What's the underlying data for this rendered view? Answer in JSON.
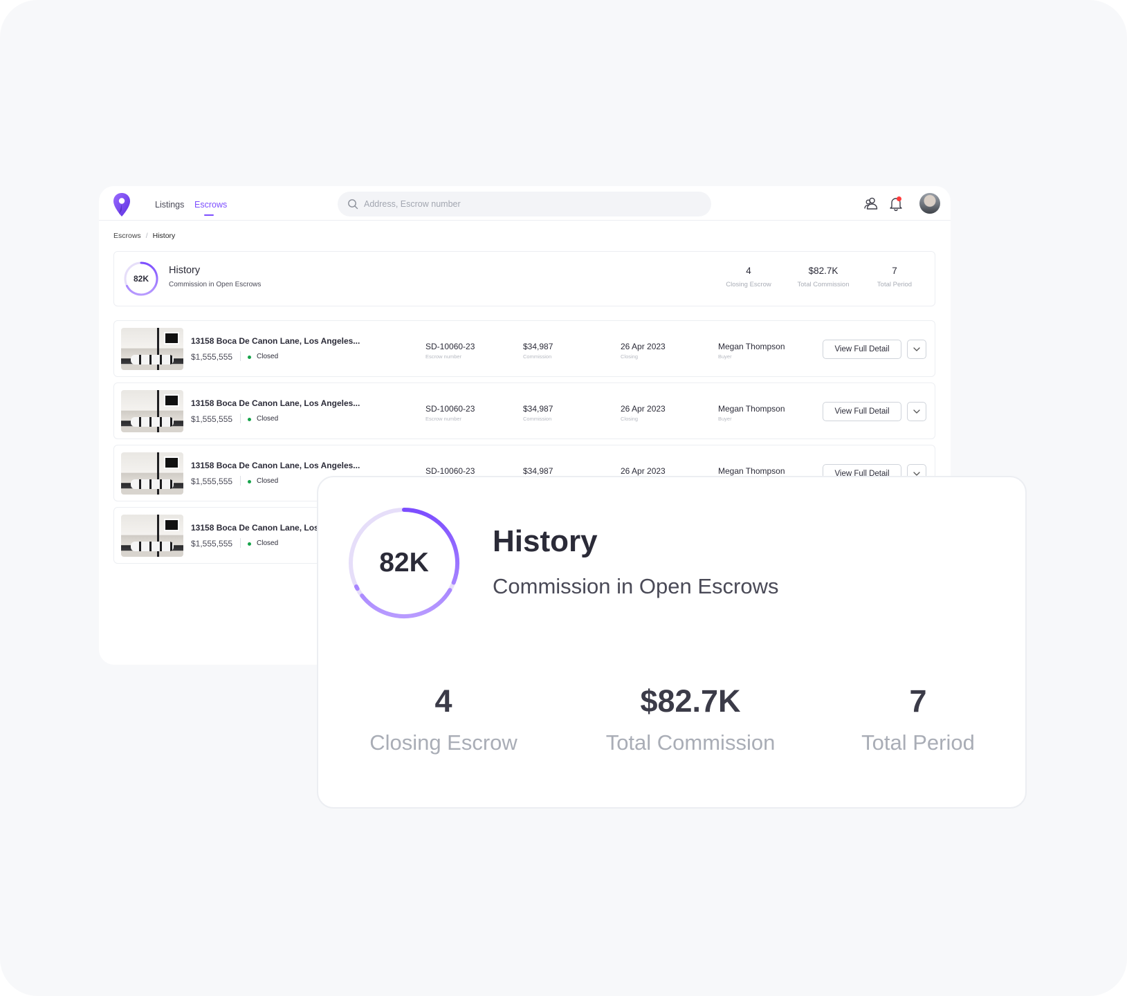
{
  "nav": {
    "links": [
      "Listings",
      "Escrows"
    ],
    "active": "Escrows"
  },
  "search": {
    "placeholder": "Address, Escrow number"
  },
  "icons": {
    "logo": "map-pin-logo-icon",
    "search": "search-icon",
    "users": "users-icon",
    "notifications": "bell-icon",
    "chevron": "chevron-down-icon"
  },
  "breadcrumb": {
    "parent": "Escrows",
    "separator": "/",
    "current": "History"
  },
  "summary": {
    "ring_label": "82K",
    "title": "History",
    "subtitle": "Commission in Open Escrows",
    "stats": [
      {
        "value": "4",
        "label": "Closing Escrow"
      },
      {
        "value": "$82.7K",
        "label": "Total Commission"
      },
      {
        "value": "7",
        "label": "Total Period"
      }
    ]
  },
  "rows": [
    {
      "address": "13158 Boca De Canon Lane, Los Angeles...",
      "price": "$1,555,555",
      "status": "Closed",
      "escrow_number": "SD-10060-23",
      "escrow_number_label": "Escrow number",
      "commission": "$34,987",
      "commission_label": "Commission",
      "closing": "26 Apr 2023",
      "closing_label": "Closing",
      "person": "Megan Thompson",
      "person_label": "Buyer",
      "button": "View Full Detail"
    },
    {
      "address": "13158 Boca De Canon Lane, Los Angeles...",
      "price": "$1,555,555",
      "status": "Closed",
      "escrow_number": "SD-10060-23",
      "escrow_number_label": "Escrow number",
      "commission": "$34,987",
      "commission_label": "Commission",
      "closing": "26 Apr 2023",
      "closing_label": "Closing",
      "person": "Megan Thompson",
      "person_label": "Buyer",
      "button": "View Full Detail"
    },
    {
      "address": "13158 Boca De Canon Lane, Los Angeles...",
      "price": "$1,555,555",
      "status": "Closed",
      "escrow_number": "SD-10060-23",
      "commission": "$34,987",
      "closing": "26 Apr 2023",
      "person": "Megan Thompson",
      "button": "View Full Detail"
    },
    {
      "address": "13158 Boca De Canon Lane, Los",
      "price": "$1,555,555",
      "status": "Closed"
    }
  ],
  "zoom_card": {
    "ring_label": "82K",
    "title": "History",
    "subtitle": "Commission in Open Escrows",
    "stats": [
      {
        "value": "4",
        "label": "Closing Escrow"
      },
      {
        "value": "$82.7K",
        "label": "Total Commission"
      },
      {
        "value": "7",
        "label": "Total Period"
      }
    ]
  },
  "colors": {
    "accent": "#7c4dff",
    "ring_light": "#d9cdf9",
    "status_closed": "#16a34a",
    "notification_dot": "#ff3b3b",
    "muted_text": "#a9adb6"
  }
}
